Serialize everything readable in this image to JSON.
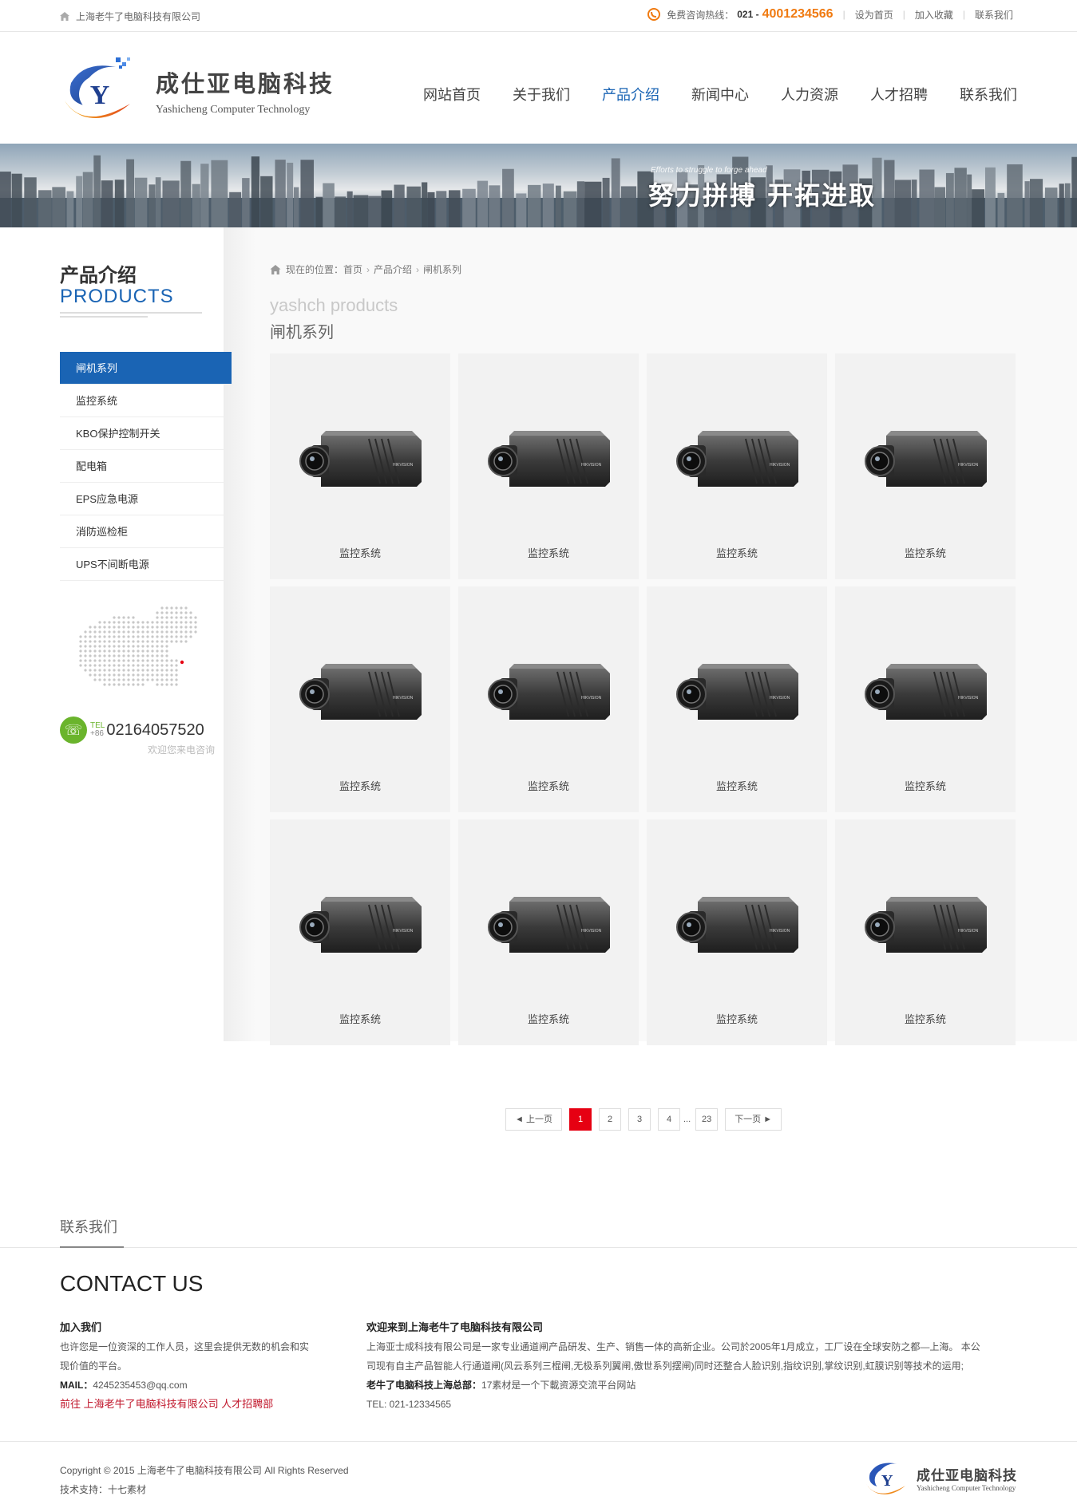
{
  "topbar": {
    "company": "上海老牛了电脑科技有限公司",
    "hotline_label": "免费咨询热线：",
    "hotline_area": "021 -",
    "hotline_number": "4001234566",
    "links": [
      "设为首页",
      "加入收藏",
      "联系我们"
    ]
  },
  "header": {
    "logo_cn": "成仕亚电脑科技",
    "logo_en": "Yashicheng Computer Technology",
    "nav": [
      "网站首页",
      "关于我们",
      "产品介绍",
      "新闻中心",
      "人力资源",
      "人才招聘",
      "联系我们"
    ],
    "nav_active": "产品介绍"
  },
  "banner": {
    "slogan_en": "Efforts to struggle to forge ahead",
    "slogan": "努力拼搏 开拓进取"
  },
  "sidebar": {
    "title_cn": "产品介绍",
    "title_en": "PRODUCTS",
    "menu": [
      "闸机系列",
      "监控系统",
      "KBO保护控制开关",
      "配电箱",
      "EPS应急电源",
      "消防巡检柜",
      "UPS不间断电源"
    ],
    "tel_label_1": "TEL",
    "tel_label_2": "+86",
    "tel_number": "02164057520",
    "tel_sub": "欢迎您来电咨询"
  },
  "breadcrumb": {
    "label": "现在的位置：",
    "items": [
      "首页",
      "产品介绍",
      "闸机系列"
    ]
  },
  "section": {
    "title_en": "yashch products",
    "title_cn": "闸机系列"
  },
  "products": [
    "监控系统",
    "监控系统",
    "监控系统",
    "监控系统",
    "监控系统",
    "监控系统",
    "监控系统",
    "监控系统",
    "监控系统",
    "监控系统",
    "监控系统",
    "监控系统"
  ],
  "pager": {
    "prev": "◄ 上一页",
    "pages": [
      "1",
      "2",
      "3",
      "4"
    ],
    "current": "1",
    "dots": "...",
    "last": "23",
    "next": "下一页 ►"
  },
  "contact": {
    "heading": "联系我们",
    "title": "CONTACT US",
    "join_title": "加入我们",
    "join_text": "也许您是一位资深的工作人员，这里会提供无数的机会和实现价值的平台。",
    "mail_label": "MAIL：",
    "mail": "4245235453@qq.com",
    "recruit_link": "前往 上海老牛了电脑科技有限公司 人才招聘部",
    "welcome_title": "欢迎来到上海老牛了电脑科技有限公司",
    "welcome_text": "上海亚士成科技有限公司是一家专业通道闸产品研发、生产、销售一体的高新企业。公司於2005年1月成立，工厂设在全球安防之都—上海。 本公司现有自主产品智能人行通道闸(风云系列三棍闸,无极系列翼闸,傲世系列摆闸)同时还整合人脸识别,指纹识别,掌纹识别,虹膜识别等技术的运用;",
    "hq_label": "老牛了电脑科技上海总部：",
    "hq_text": "17素材是一个下載资源交流平台网站",
    "tel": "TEL: 021-12334565"
  },
  "footer": {
    "copyright": "Copyright © 2015 上海老牛了电脑科技有限公司 All Rights Reserved",
    "support": "技术支持：十七素材",
    "logo_cn": "成仕亚电脑科技",
    "logo_en": "Yashicheng Computer Technology"
  },
  "colors": {
    "accent": "#1a64b4",
    "hotline": "#f07a10",
    "pager_current": "#e60012",
    "link_red": "#c0152a"
  }
}
